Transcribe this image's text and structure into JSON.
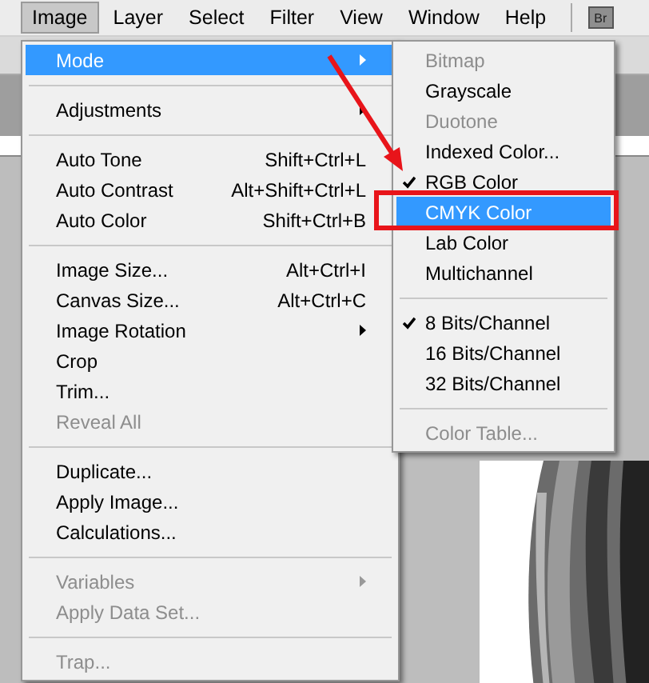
{
  "menubar": {
    "items": [
      {
        "label": "Image",
        "selected": true
      },
      {
        "label": "Layer",
        "selected": false
      },
      {
        "label": "Select",
        "selected": false
      },
      {
        "label": "Filter",
        "selected": false
      },
      {
        "label": "View",
        "selected": false
      },
      {
        "label": "Window",
        "selected": false
      },
      {
        "label": "Help",
        "selected": false
      }
    ],
    "bridge_button": "Br"
  },
  "menu": {
    "items": [
      {
        "kind": "item",
        "label": "Mode",
        "submenu": true,
        "selected": true,
        "disabled": false
      },
      {
        "kind": "separator"
      },
      {
        "kind": "item",
        "label": "Adjustments",
        "submenu": true,
        "selected": false,
        "disabled": false
      },
      {
        "kind": "separator"
      },
      {
        "kind": "item",
        "label": "Auto Tone",
        "shortcut": "Shift+Ctrl+L",
        "selected": false,
        "disabled": false
      },
      {
        "kind": "item",
        "label": "Auto Contrast",
        "shortcut": "Alt+Shift+Ctrl+L",
        "selected": false,
        "disabled": false
      },
      {
        "kind": "item",
        "label": "Auto Color",
        "shortcut": "Shift+Ctrl+B",
        "selected": false,
        "disabled": false
      },
      {
        "kind": "separator"
      },
      {
        "kind": "item",
        "label": "Image Size...",
        "shortcut": "Alt+Ctrl+I",
        "selected": false,
        "disabled": false
      },
      {
        "kind": "item",
        "label": "Canvas Size...",
        "shortcut": "Alt+Ctrl+C",
        "selected": false,
        "disabled": false
      },
      {
        "kind": "item",
        "label": "Image Rotation",
        "submenu": true,
        "selected": false,
        "disabled": false
      },
      {
        "kind": "item",
        "label": "Crop",
        "selected": false,
        "disabled": false
      },
      {
        "kind": "item",
        "label": "Trim...",
        "selected": false,
        "disabled": false
      },
      {
        "kind": "item",
        "label": "Reveal All",
        "selected": false,
        "disabled": true
      },
      {
        "kind": "separator"
      },
      {
        "kind": "item",
        "label": "Duplicate...",
        "selected": false,
        "disabled": false
      },
      {
        "kind": "item",
        "label": "Apply Image...",
        "selected": false,
        "disabled": false
      },
      {
        "kind": "item",
        "label": "Calculations...",
        "selected": false,
        "disabled": false
      },
      {
        "kind": "separator"
      },
      {
        "kind": "item",
        "label": "Variables",
        "submenu": true,
        "selected": false,
        "disabled": true
      },
      {
        "kind": "item",
        "label": "Apply Data Set...",
        "selected": false,
        "disabled": true
      },
      {
        "kind": "separator"
      },
      {
        "kind": "item",
        "label": "Trap...",
        "selected": false,
        "disabled": true
      }
    ]
  },
  "submenu": {
    "items": [
      {
        "kind": "item",
        "label": "Bitmap",
        "checked": false,
        "selected": false,
        "disabled": true
      },
      {
        "kind": "item",
        "label": "Grayscale",
        "checked": false,
        "selected": false,
        "disabled": false
      },
      {
        "kind": "item",
        "label": "Duotone",
        "checked": false,
        "selected": false,
        "disabled": true
      },
      {
        "kind": "item",
        "label": "Indexed Color...",
        "checked": false,
        "selected": false,
        "disabled": false
      },
      {
        "kind": "item",
        "label": "RGB Color",
        "checked": true,
        "selected": false,
        "disabled": false
      },
      {
        "kind": "item",
        "label": "CMYK Color",
        "checked": false,
        "selected": true,
        "disabled": false
      },
      {
        "kind": "item",
        "label": "Lab Color",
        "checked": false,
        "selected": false,
        "disabled": false
      },
      {
        "kind": "item",
        "label": "Multichannel",
        "checked": false,
        "selected": false,
        "disabled": false
      },
      {
        "kind": "separator"
      },
      {
        "kind": "item",
        "label": "8 Bits/Channel",
        "checked": true,
        "selected": false,
        "disabled": false
      },
      {
        "kind": "item",
        "label": "16 Bits/Channel",
        "checked": false,
        "selected": false,
        "disabled": false
      },
      {
        "kind": "item",
        "label": "32 Bits/Channel",
        "checked": false,
        "selected": false,
        "disabled": false
      },
      {
        "kind": "separator"
      },
      {
        "kind": "item",
        "label": "Color Table...",
        "checked": false,
        "selected": false,
        "disabled": true
      }
    ]
  }
}
